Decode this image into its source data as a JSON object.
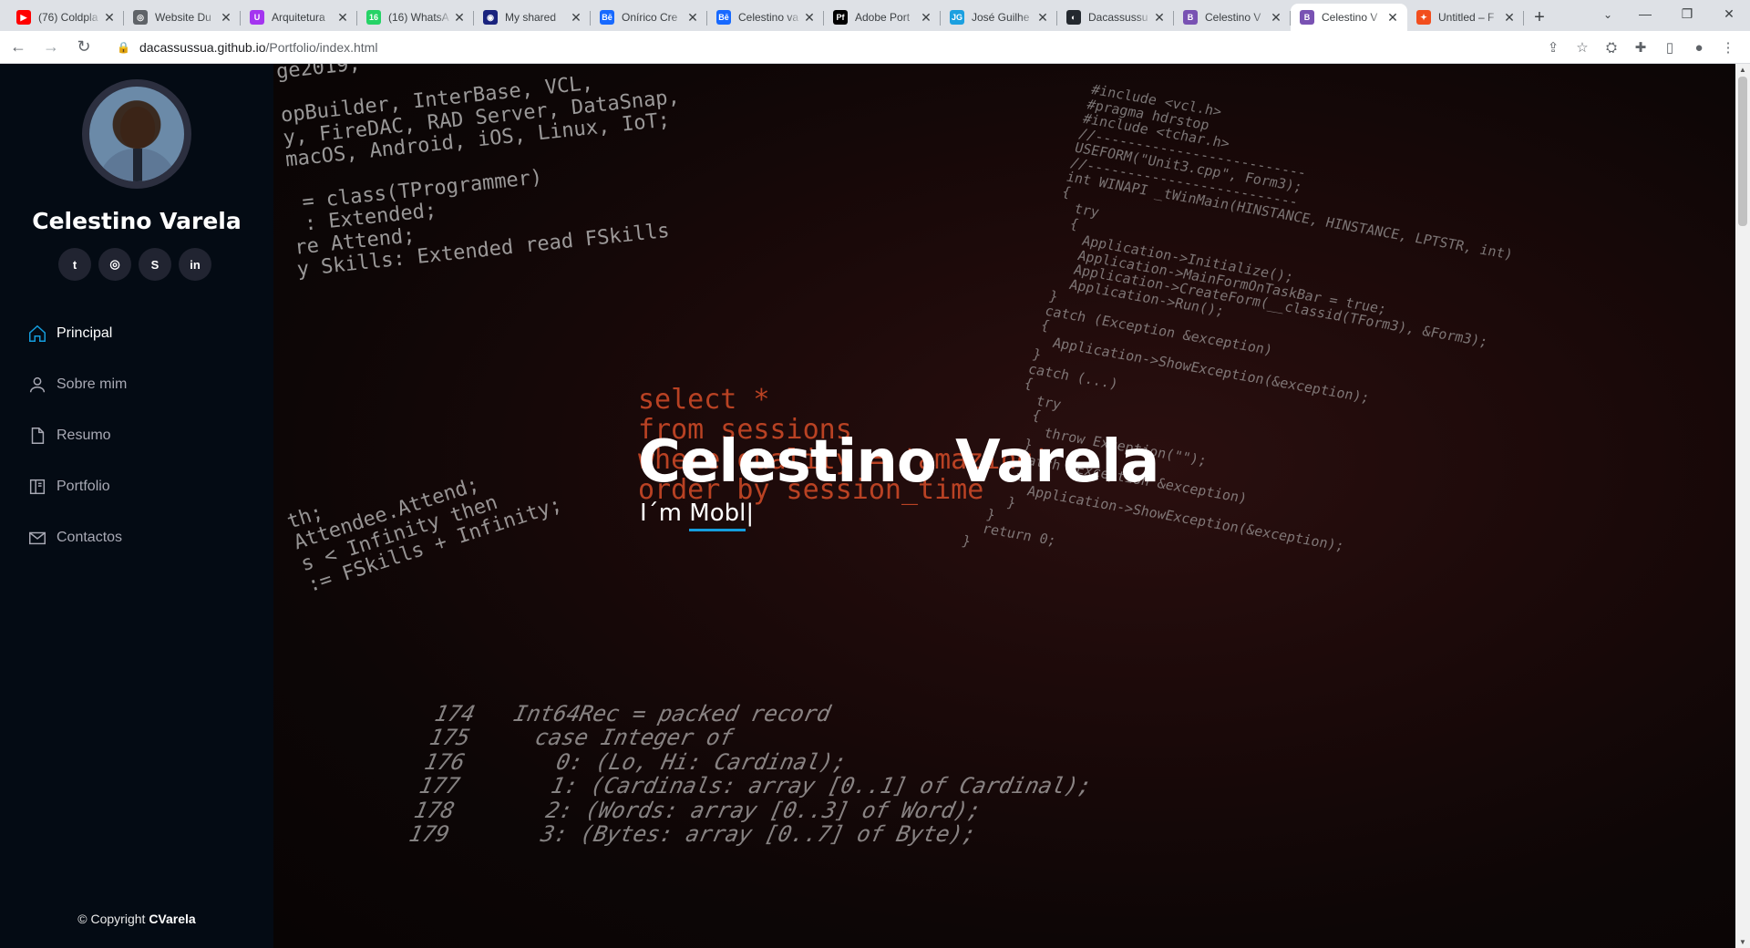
{
  "browser": {
    "tabs": [
      {
        "label": "(76) Coldpla",
        "fav": "▶",
        "color": "#ff0000"
      },
      {
        "label": "Website Du",
        "fav": "◎",
        "color": "#5f6368"
      },
      {
        "label": "Arquitetura",
        "fav": "U",
        "color": "#a435f0"
      },
      {
        "label": "(16) WhatsA",
        "fav": "16",
        "color": "#25d366"
      },
      {
        "label": "My shared",
        "fav": "◉",
        "color": "#1a237e"
      },
      {
        "label": "Onírico Cre",
        "fav": "Bē",
        "color": "#1769ff"
      },
      {
        "label": "Celestino va",
        "fav": "Bē",
        "color": "#1769ff"
      },
      {
        "label": "Adobe Port",
        "fav": "Pf",
        "color": "#000000"
      },
      {
        "label": "José Guilhe",
        "fav": "JG",
        "color": "#1ba0e0"
      },
      {
        "label": "Dacassussu",
        "fav": "◐",
        "color": "#24292f"
      },
      {
        "label": "Celestino V",
        "fav": "B",
        "color": "#7952b3"
      },
      {
        "label": "Celestino V",
        "fav": "B",
        "color": "#7952b3",
        "active": true
      },
      {
        "label": "Untitled – F",
        "fav": "✦",
        "color": "#f24e1e"
      }
    ],
    "url_host": "dacassussua.github.io",
    "url_path": "/Portfolio/index.html"
  },
  "sidebar": {
    "name": "Celestino Varela",
    "socials": [
      {
        "icon": "twitter-icon",
        "glyph": "t"
      },
      {
        "icon": "instagram-icon",
        "glyph": "◎"
      },
      {
        "icon": "skype-icon",
        "glyph": "S"
      },
      {
        "icon": "linkedin-icon",
        "glyph": "in"
      }
    ],
    "nav": [
      {
        "label": "Principal",
        "icon": "home-icon",
        "active": true
      },
      {
        "label": "Sobre mim",
        "icon": "person-icon"
      },
      {
        "label": "Resumo",
        "icon": "file-icon"
      },
      {
        "label": "Portfolio",
        "icon": "book-icon"
      },
      {
        "label": "Contactos",
        "icon": "envelope-icon"
      }
    ],
    "copyright_prefix": "© Copyright",
    "copyright_name": "CVarela"
  },
  "hero": {
    "title": "Celestino Varela",
    "subtitle_prefix": "I´m",
    "subtitle_typed": "Mobl"
  },
  "colors": {
    "accent": "#149ddd",
    "sidebar_bg": "#040b14"
  }
}
